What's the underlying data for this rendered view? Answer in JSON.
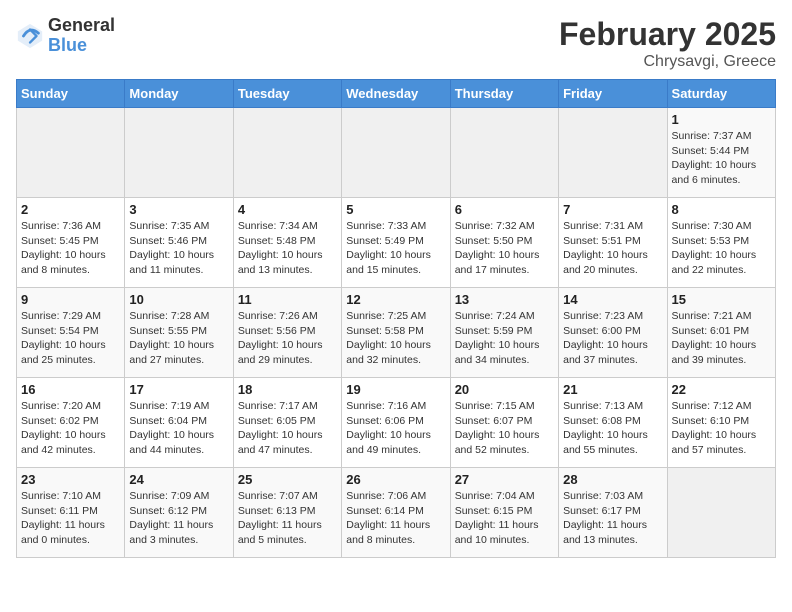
{
  "logo": {
    "general": "General",
    "blue": "Blue"
  },
  "title": "February 2025",
  "subtitle": "Chrysavgi, Greece",
  "days_of_week": [
    "Sunday",
    "Monday",
    "Tuesday",
    "Wednesday",
    "Thursday",
    "Friday",
    "Saturday"
  ],
  "weeks": [
    [
      {
        "day": "",
        "info": ""
      },
      {
        "day": "",
        "info": ""
      },
      {
        "day": "",
        "info": ""
      },
      {
        "day": "",
        "info": ""
      },
      {
        "day": "",
        "info": ""
      },
      {
        "day": "",
        "info": ""
      },
      {
        "day": "1",
        "info": "Sunrise: 7:37 AM\nSunset: 5:44 PM\nDaylight: 10 hours and 6 minutes."
      }
    ],
    [
      {
        "day": "2",
        "info": "Sunrise: 7:36 AM\nSunset: 5:45 PM\nDaylight: 10 hours and 8 minutes."
      },
      {
        "day": "3",
        "info": "Sunrise: 7:35 AM\nSunset: 5:46 PM\nDaylight: 10 hours and 11 minutes."
      },
      {
        "day": "4",
        "info": "Sunrise: 7:34 AM\nSunset: 5:48 PM\nDaylight: 10 hours and 13 minutes."
      },
      {
        "day": "5",
        "info": "Sunrise: 7:33 AM\nSunset: 5:49 PM\nDaylight: 10 hours and 15 minutes."
      },
      {
        "day": "6",
        "info": "Sunrise: 7:32 AM\nSunset: 5:50 PM\nDaylight: 10 hours and 17 minutes."
      },
      {
        "day": "7",
        "info": "Sunrise: 7:31 AM\nSunset: 5:51 PM\nDaylight: 10 hours and 20 minutes."
      },
      {
        "day": "8",
        "info": "Sunrise: 7:30 AM\nSunset: 5:53 PM\nDaylight: 10 hours and 22 minutes."
      }
    ],
    [
      {
        "day": "9",
        "info": "Sunrise: 7:29 AM\nSunset: 5:54 PM\nDaylight: 10 hours and 25 minutes."
      },
      {
        "day": "10",
        "info": "Sunrise: 7:28 AM\nSunset: 5:55 PM\nDaylight: 10 hours and 27 minutes."
      },
      {
        "day": "11",
        "info": "Sunrise: 7:26 AM\nSunset: 5:56 PM\nDaylight: 10 hours and 29 minutes."
      },
      {
        "day": "12",
        "info": "Sunrise: 7:25 AM\nSunset: 5:58 PM\nDaylight: 10 hours and 32 minutes."
      },
      {
        "day": "13",
        "info": "Sunrise: 7:24 AM\nSunset: 5:59 PM\nDaylight: 10 hours and 34 minutes."
      },
      {
        "day": "14",
        "info": "Sunrise: 7:23 AM\nSunset: 6:00 PM\nDaylight: 10 hours and 37 minutes."
      },
      {
        "day": "15",
        "info": "Sunrise: 7:21 AM\nSunset: 6:01 PM\nDaylight: 10 hours and 39 minutes."
      }
    ],
    [
      {
        "day": "16",
        "info": "Sunrise: 7:20 AM\nSunset: 6:02 PM\nDaylight: 10 hours and 42 minutes."
      },
      {
        "day": "17",
        "info": "Sunrise: 7:19 AM\nSunset: 6:04 PM\nDaylight: 10 hours and 44 minutes."
      },
      {
        "day": "18",
        "info": "Sunrise: 7:17 AM\nSunset: 6:05 PM\nDaylight: 10 hours and 47 minutes."
      },
      {
        "day": "19",
        "info": "Sunrise: 7:16 AM\nSunset: 6:06 PM\nDaylight: 10 hours and 49 minutes."
      },
      {
        "day": "20",
        "info": "Sunrise: 7:15 AM\nSunset: 6:07 PM\nDaylight: 10 hours and 52 minutes."
      },
      {
        "day": "21",
        "info": "Sunrise: 7:13 AM\nSunset: 6:08 PM\nDaylight: 10 hours and 55 minutes."
      },
      {
        "day": "22",
        "info": "Sunrise: 7:12 AM\nSunset: 6:10 PM\nDaylight: 10 hours and 57 minutes."
      }
    ],
    [
      {
        "day": "23",
        "info": "Sunrise: 7:10 AM\nSunset: 6:11 PM\nDaylight: 11 hours and 0 minutes."
      },
      {
        "day": "24",
        "info": "Sunrise: 7:09 AM\nSunset: 6:12 PM\nDaylight: 11 hours and 3 minutes."
      },
      {
        "day": "25",
        "info": "Sunrise: 7:07 AM\nSunset: 6:13 PM\nDaylight: 11 hours and 5 minutes."
      },
      {
        "day": "26",
        "info": "Sunrise: 7:06 AM\nSunset: 6:14 PM\nDaylight: 11 hours and 8 minutes."
      },
      {
        "day": "27",
        "info": "Sunrise: 7:04 AM\nSunset: 6:15 PM\nDaylight: 11 hours and 10 minutes."
      },
      {
        "day": "28",
        "info": "Sunrise: 7:03 AM\nSunset: 6:17 PM\nDaylight: 11 hours and 13 minutes."
      },
      {
        "day": "",
        "info": ""
      }
    ]
  ]
}
